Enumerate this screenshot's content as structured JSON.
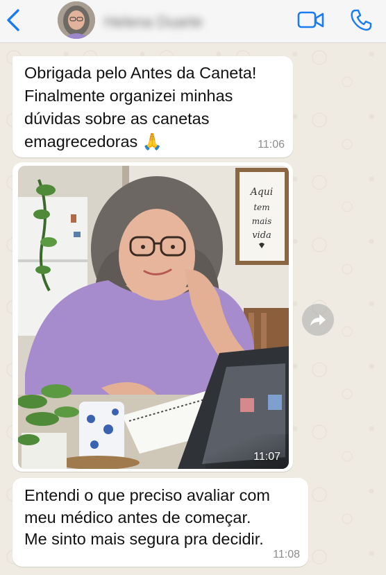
{
  "header": {
    "contact_name": "Helena Duarte",
    "icons": {
      "back": "chevron-left-icon",
      "video": "video-call-icon",
      "phone": "voice-call-icon"
    },
    "accent_color": "#1a7cf2"
  },
  "chat": {
    "wallpaper_color": "#efeae2",
    "bubble_color": "#ffffff",
    "messages": [
      {
        "text": "Obrigada pelo Antes da Caneta!\nFinalmente organizei minhas\ndúvidas sobre as canetas\nemagrecedoras 🙏",
        "time": "11:06"
      },
      {
        "type": "image",
        "image_caption_text": "Aqui\ntem\nmais\nvida",
        "time": "11:07"
      },
      {
        "text": "Entendi o que preciso avaliar com\nmeu médico antes de começar.\nMe sinto mais segura pra decidir.",
        "time": "11:08"
      }
    ],
    "forward_icon": "forward-share-icon"
  }
}
